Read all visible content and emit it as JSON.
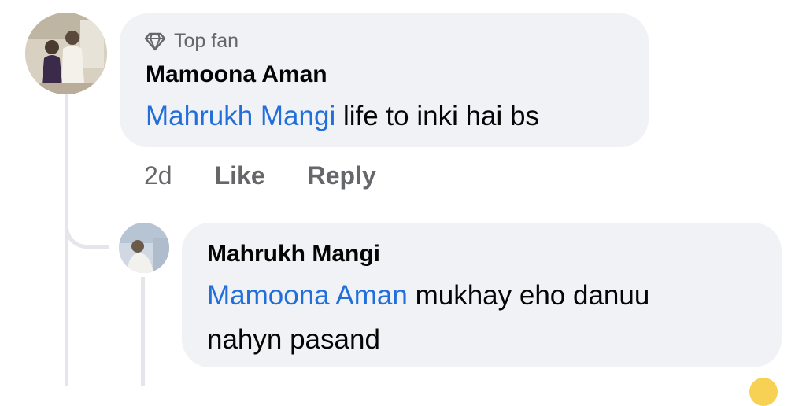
{
  "comment": {
    "badge": "Top fan",
    "badge_icon": "diamond-icon",
    "author": "Mamoona Aman",
    "mention": "Mahrukh Mangi",
    "text": " life to inki hai bs",
    "time": "2d",
    "like_label": "Like",
    "reply_label": "Reply"
  },
  "reply": {
    "author": "Mahrukh Mangi",
    "mention": "Mamoona Aman",
    "line1": " mukhay eho danuu",
    "line2": "nahyn pasand"
  },
  "colors": {
    "bubble": "#f0f2f5",
    "mention": "#216fdb",
    "secondary_text": "#65676b"
  }
}
